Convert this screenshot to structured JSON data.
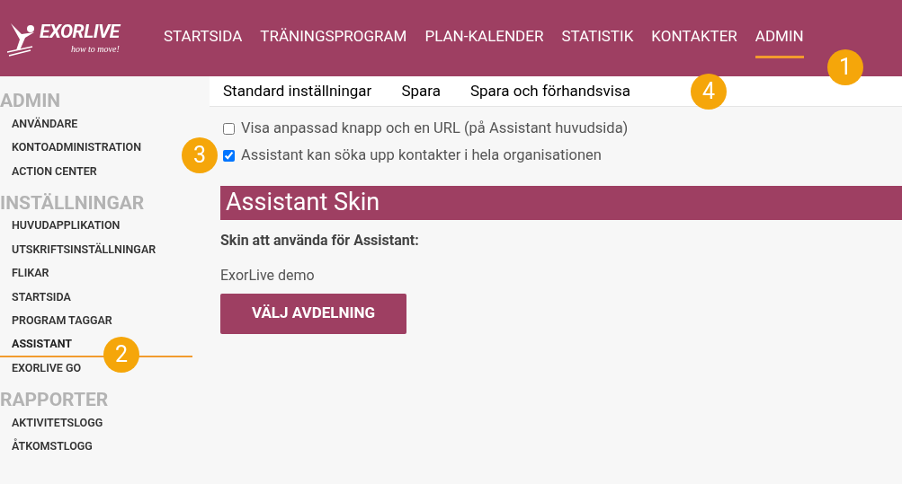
{
  "logo": {
    "name": "EXORLIVE",
    "tagline": "how to move!"
  },
  "nav": [
    {
      "label": "STARTSIDA",
      "selected": false
    },
    {
      "label": "TRÄNINGSPROGRAM",
      "selected": false
    },
    {
      "label": "PLAN-KALENDER",
      "selected": false
    },
    {
      "label": "STATISTIK",
      "selected": false
    },
    {
      "label": "KONTAKTER",
      "selected": false
    },
    {
      "label": "ADMIN",
      "selected": true
    }
  ],
  "sidebar": [
    {
      "heading": "ADMIN",
      "items": [
        {
          "label": "ANVÄNDARE",
          "selected": false
        },
        {
          "label": "KONTOADMINISTRATION",
          "selected": false
        },
        {
          "label": "ACTION CENTER",
          "selected": false
        }
      ]
    },
    {
      "heading": "INSTÄLLNINGAR",
      "items": [
        {
          "label": "HUVUDAPPLIKATION",
          "selected": false
        },
        {
          "label": "UTSKRIFTSINSTÄLLNINGAR",
          "selected": false
        },
        {
          "label": "FLIKAR",
          "selected": false
        },
        {
          "label": "STARTSIDA",
          "selected": false
        },
        {
          "label": "PROGRAM TAGGAR",
          "selected": false
        },
        {
          "label": "ASSISTANT",
          "selected": true
        },
        {
          "label": "EXORLIVE GO",
          "selected": false
        }
      ]
    },
    {
      "heading": "RAPPORTER",
      "items": [
        {
          "label": "AKTIVITETSLOGG",
          "selected": false
        },
        {
          "label": "ÅTKOMSTLOGG",
          "selected": false
        }
      ]
    }
  ],
  "toolbar": [
    "Standard inställningar",
    "Spara",
    "Spara och förhandsvisa"
  ],
  "options": [
    {
      "label": "Visa anpassad knapp och en URL (på Assistant huvudsida)",
      "checked": false
    },
    {
      "label": "Assistant kan söka upp kontakter i hela organisationen",
      "checked": true
    }
  ],
  "section": {
    "title": "Assistant Skin",
    "field_label": "Skin att använda för Assistant:",
    "value": "ExorLive demo",
    "button": "VÄLJ AVDELNING"
  },
  "callouts": [
    "1",
    "2",
    "3",
    "4"
  ]
}
